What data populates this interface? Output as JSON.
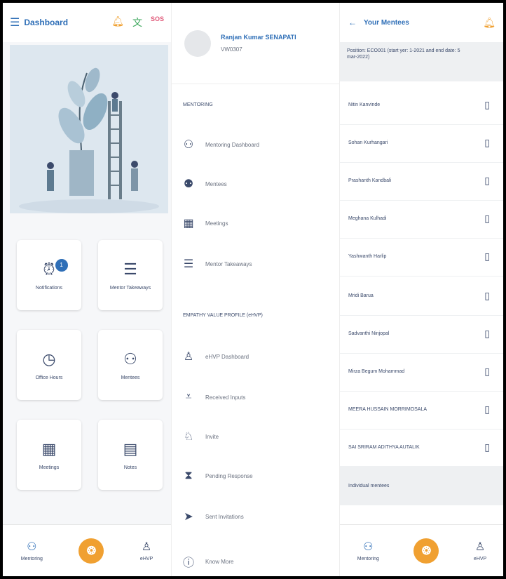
{
  "dashboard": {
    "title": "Dashboard",
    "header_icons": [
      "bell-icon",
      "translate-icon",
      "sos-icon"
    ],
    "tiles": [
      {
        "label": "Notifications",
        "icon": "alarm-icon",
        "badge": "1"
      },
      {
        "label": "Mentor Takeaways",
        "icon": "checklist-icon"
      },
      {
        "label": "Office Hours",
        "icon": "clock-icon"
      },
      {
        "label": "Mentees",
        "icon": "mentees-icon"
      },
      {
        "label": "Meetings",
        "icon": "calendar-icon"
      },
      {
        "label": "Notes",
        "icon": "notes-icon"
      }
    ],
    "bottom_nav": [
      {
        "label": "Mentoring",
        "icon": "people-icon"
      },
      {
        "label": "",
        "icon": "logo-icon"
      },
      {
        "label": "eHVP",
        "icon": "ehvp-icon"
      }
    ]
  },
  "drawer": {
    "name": "Ranjan Kumar SENAPATI",
    "id": "VW0307",
    "sections": [
      {
        "title": "MENTORING",
        "items": [
          {
            "label": "Mentoring Dashboard",
            "icon": "people-icon"
          },
          {
            "label": "Mentees",
            "icon": "mentees-icon"
          },
          {
            "label": "Meetings",
            "icon": "calendar-icon"
          },
          {
            "label": "Mentor Takeaways",
            "icon": "checklist-icon"
          }
        ]
      },
      {
        "title": "EMPATHY VALUE PROFILE (eHVP)",
        "items": [
          {
            "label": "eHVP Dashboard",
            "icon": "dashboard-icon"
          },
          {
            "label": "Received Inputs",
            "icon": "inputs-icon"
          },
          {
            "label": "Invite",
            "icon": "invite-icon"
          },
          {
            "label": "Pending Response",
            "icon": "hourglass-icon"
          },
          {
            "label": "Sent Invitations",
            "icon": "send-icon"
          }
        ]
      }
    ],
    "footer_item": {
      "label": "Know More",
      "icon": "info-icon"
    }
  },
  "mentees": {
    "title": "Your Mentees",
    "position_line1": "Position: ECO001 (start yer: 1-2021 and end date: 5",
    "position_line2": "mar-2022)",
    "list": [
      "Nitin Kanvinde",
      "Sohan Kurhangari",
      "Prashanth Kandbali",
      "Meghana Kulhadi",
      "Yashwanth Harlip",
      "Mridi Barua",
      "Sadvanthi Ninjopal",
      "Mirza Begum Mohammad",
      "MEERA HUSSAIN MORRIMOSALA",
      "SAI SRIRAM ADITHYA AUTALIK"
    ],
    "subheader": "Individual mentees"
  }
}
